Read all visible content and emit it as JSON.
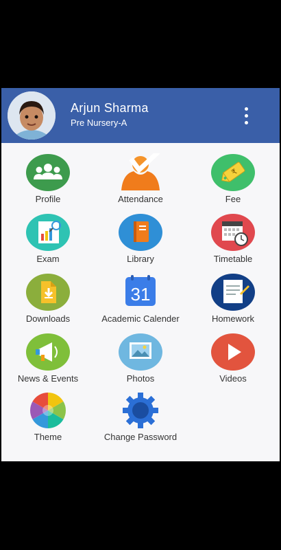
{
  "header": {
    "name": "Arjun Sharma",
    "class": "Pre Nursery-A"
  },
  "tiles": [
    {
      "label": "Profile",
      "icon": "profile-group-icon"
    },
    {
      "label": "Attendance",
      "icon": "attendance-check-icon"
    },
    {
      "label": "Fee",
      "icon": "fee-tag-icon"
    },
    {
      "label": "Exam",
      "icon": "exam-chart-icon"
    },
    {
      "label": "Library",
      "icon": "library-book-icon"
    },
    {
      "label": "Timetable",
      "icon": "timetable-calendar-clock-icon"
    },
    {
      "label": "Downloads",
      "icon": "downloads-file-icon"
    },
    {
      "label": "Academic Calender",
      "icon": "calendar-31-icon"
    },
    {
      "label": "Homework",
      "icon": "homework-notepad-icon"
    },
    {
      "label": "News & Events",
      "icon": "megaphone-icon"
    },
    {
      "label": "Photos",
      "icon": "photos-icon"
    },
    {
      "label": "Videos",
      "icon": "play-icon"
    },
    {
      "label": "Theme",
      "icon": "color-wheel-icon"
    },
    {
      "label": "Change Password",
      "icon": "gear-icon"
    }
  ],
  "calendar_day": "31",
  "fee_tag_text": "₹"
}
